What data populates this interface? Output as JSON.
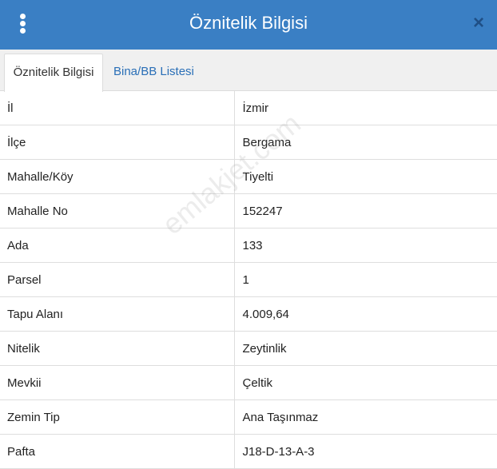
{
  "header": {
    "title": "Öznitelik Bilgisi",
    "close_label": "×"
  },
  "tabs": [
    {
      "label": "Öznitelik Bilgisi",
      "active": true
    },
    {
      "label": "Bina/BB Listesi",
      "active": false
    }
  ],
  "rows": [
    {
      "label": "İl",
      "value": "İzmir"
    },
    {
      "label": "İlçe",
      "value": "Bergama"
    },
    {
      "label": "Mahalle/Köy",
      "value": "Tiyelti"
    },
    {
      "label": "Mahalle No",
      "value": "152247"
    },
    {
      "label": "Ada",
      "value": "133"
    },
    {
      "label": "Parsel",
      "value": "1"
    },
    {
      "label": "Tapu Alanı",
      "value": "4.009,64"
    },
    {
      "label": "Nitelik",
      "value": "Zeytinlik"
    },
    {
      "label": "Mevkii",
      "value": "Çeltik"
    },
    {
      "label": "Zemin Tip",
      "value": "Ana Taşınmaz"
    },
    {
      "label": "Pafta",
      "value": "J18-D-13-A-3"
    }
  ],
  "watermark": "emlakjet.com",
  "colors": {
    "header_bg": "#3a7fc4",
    "tab_link": "#2a6fb7"
  }
}
